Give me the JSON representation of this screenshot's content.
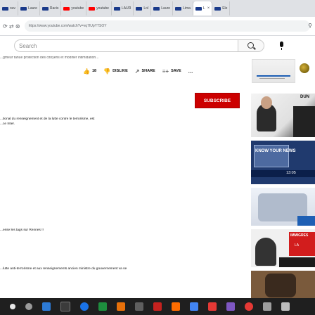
{
  "browser": {
    "tabs": [
      {
        "label": "ouv",
        "favicon": "ouest-france"
      },
      {
        "label": "Laure",
        "favicon": "ouest-france"
      },
      {
        "label": "Racis",
        "favicon": "ouest-france"
      },
      {
        "label": "youtube",
        "favicon": "youtube"
      },
      {
        "label": "youtube",
        "favicon": "youtube"
      },
      {
        "label": "LAUR",
        "favicon": "ouest-france"
      },
      {
        "label": "Loï",
        "favicon": "ouest-france"
      },
      {
        "label": "Laure",
        "favicon": "ouest-france"
      },
      {
        "label": "Lima",
        "favicon": "ouest-france"
      },
      {
        "label": "L",
        "favicon": "ouest-france",
        "active": true,
        "close": "×"
      },
      {
        "label": "Ele",
        "favicon": "ouest-france"
      }
    ],
    "url": "https://www.youtube.com/watch?v=vq7IUpYTSOY",
    "nav_glyph": "⟳ ⇄ ⊛"
  },
  "youtube": {
    "search_placeholder": "Search",
    "description_fragment": "...gmeur tanue protection des citoyens et modifier intimidation...",
    "actions": {
      "like_count": "18",
      "like_icon": "thumb-up-icon",
      "dislike_label": "DISLIKE",
      "share_label": "SHARE",
      "save_label": "SAVE",
      "more": "..."
    },
    "subscribe_label": "SUBSCRIBE",
    "comments": [
      "...tional du renseignement et de la lutte contre le terrorisme, est",
      "...ce Inter.",
      "...esse les tags sur Rennes !!",
      "...lutte anti-terrorisme et aux renseignements ancien ministre du gouvernement va se"
    ],
    "sidebar": [
      {
        "label": "DUN"
      },
      {
        "label": "KNOW YOUR NEWS",
        "time": "13:05"
      },
      {
        "label": ""
      },
      {
        "label": "IMMIGRES",
        "sub": "LA"
      },
      {
        "label": ""
      }
    ]
  },
  "colors": {
    "subscribe": "#cc0000",
    "youtube_red": "#ff0000",
    "taskbar": "#1f1f1f"
  },
  "taskbar_icons": [
    "windows-icon",
    "search-icon",
    "task-view-icon",
    "file-explorer-icon",
    "edge-icon",
    "store-icon",
    "mail-icon",
    "app-icon",
    "app-icon",
    "app-icon",
    "app-icon",
    "app-icon",
    "app-icon",
    "app-icon",
    "app-icon",
    "app-icon",
    "app-icon",
    "app-icon"
  ]
}
